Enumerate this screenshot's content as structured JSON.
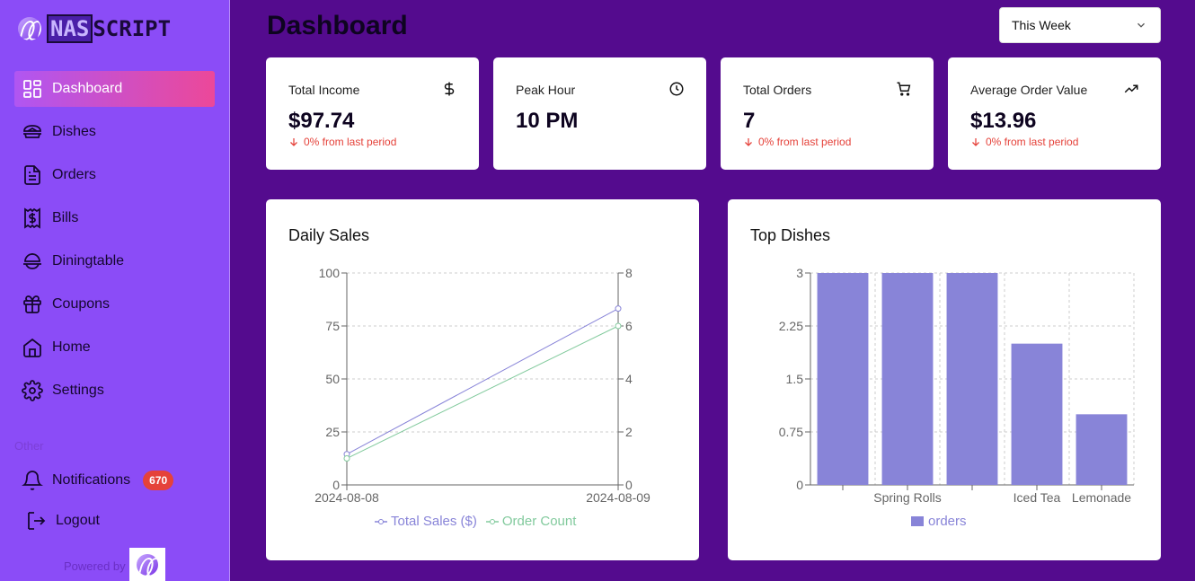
{
  "brand": {
    "nas": "NAS",
    "script": "SCRIPT"
  },
  "sidebar": {
    "items": [
      {
        "label": "Dashboard",
        "icon": "dashboard-grid-icon",
        "active": true
      },
      {
        "label": "Dishes",
        "icon": "dish-icon"
      },
      {
        "label": "Orders",
        "icon": "document-icon"
      },
      {
        "label": "Bills",
        "icon": "receipt-dollar-icon"
      },
      {
        "label": "Diningtable",
        "icon": "dining-table-icon"
      },
      {
        "label": "Coupons",
        "icon": "gift-icon"
      },
      {
        "label": "Home",
        "icon": "home-icon"
      },
      {
        "label": "Settings",
        "icon": "gear-icon"
      }
    ],
    "section_label": "Other",
    "notifications": {
      "label": "Notifications",
      "count": "670"
    },
    "logout": "Logout",
    "powered_by": "Powered by"
  },
  "header": {
    "title": "Dashboard",
    "period": "This Week"
  },
  "stats": [
    {
      "label": "Total Income",
      "value": "$97.74",
      "delta": "0% from last period",
      "icon": "dollar-icon"
    },
    {
      "label": "Peak Hour",
      "value": "10 PM",
      "delta": "",
      "icon": "clock-icon"
    },
    {
      "label": "Total Orders",
      "value": "7",
      "delta": "0% from last period",
      "icon": "cart-icon"
    },
    {
      "label": "Average Order Value",
      "value": "$13.96",
      "delta": "0% from last period",
      "icon": "trending-up-icon"
    }
  ],
  "colors": {
    "accent": "#8884d8",
    "secondary": "#82ca9d",
    "negative": "#e5423a"
  },
  "chart_data": [
    {
      "type": "line",
      "title": "Daily Sales",
      "x": [
        "2024-08-08",
        "2024-08-09"
      ],
      "series": [
        {
          "name": "Total Sales ($)",
          "values": [
            14.5,
            83.2
          ],
          "axis": "left",
          "color": "#8884d8"
        },
        {
          "name": "Order Count",
          "values": [
            1,
            6
          ],
          "axis": "right",
          "color": "#82ca9d"
        }
      ],
      "ylim_left": [
        0,
        100
      ],
      "yticks_left": [
        "0",
        "25",
        "50",
        "75",
        "100"
      ],
      "ylim_right": [
        0,
        8
      ],
      "yticks_right": [
        "0",
        "2",
        "4",
        "6",
        "8"
      ],
      "grid": true,
      "legend": "bottom"
    },
    {
      "type": "bar",
      "title": "Top Dishes",
      "values": [
        3,
        3,
        3,
        2,
        1
      ],
      "xtick_labels": [
        "",
        "Spring Rolls",
        "",
        "Iced Tea",
        "Lemonade"
      ],
      "series_name": "orders",
      "ylim": [
        0,
        3
      ],
      "yticks": [
        "0",
        "0.75",
        "1.5",
        "2.25",
        "3"
      ],
      "grid": true,
      "legend": "bottom",
      "color": "#8884d8"
    }
  ]
}
